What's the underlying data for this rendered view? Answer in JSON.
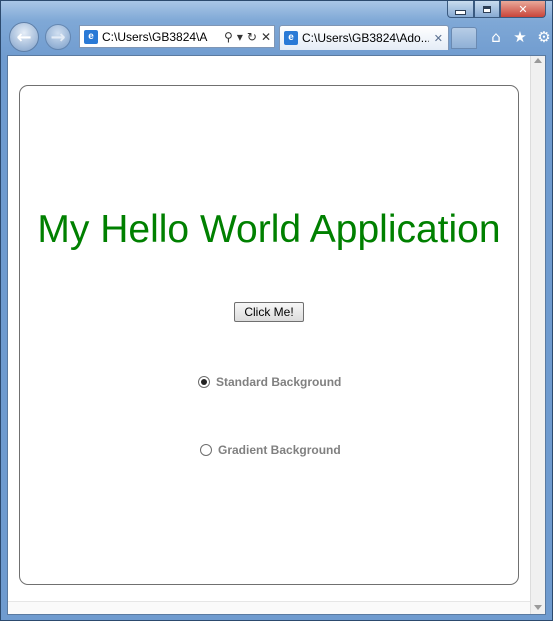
{
  "browser": {
    "address_url": "C:\\Users\\GB3824\\A",
    "tab_title": "C:\\Users\\GB3824\\Ado...",
    "tab_close_glyph": "✕",
    "icons": [
      "back-arrow-icon",
      "forward-arrow-icon",
      "ie-page-icon",
      "search-icon",
      "refresh-icon",
      "stop-icon",
      "home-icon",
      "favorites-star-icon",
      "tools-gear-icon"
    ],
    "address_tools": {
      "search": "⚲",
      "dropdown": "▾",
      "refresh": "↻",
      "stop": "✕"
    },
    "right_icons": {
      "home": "⌂",
      "favorites": "★",
      "tools": "⚙"
    }
  },
  "app": {
    "title": "My Hello World Application",
    "title_color": "#008000",
    "button_label": "Click Me!",
    "radio_options": [
      {
        "label": "Standard Background",
        "selected": true
      },
      {
        "label": "Gradient Background",
        "selected": false
      }
    ]
  }
}
